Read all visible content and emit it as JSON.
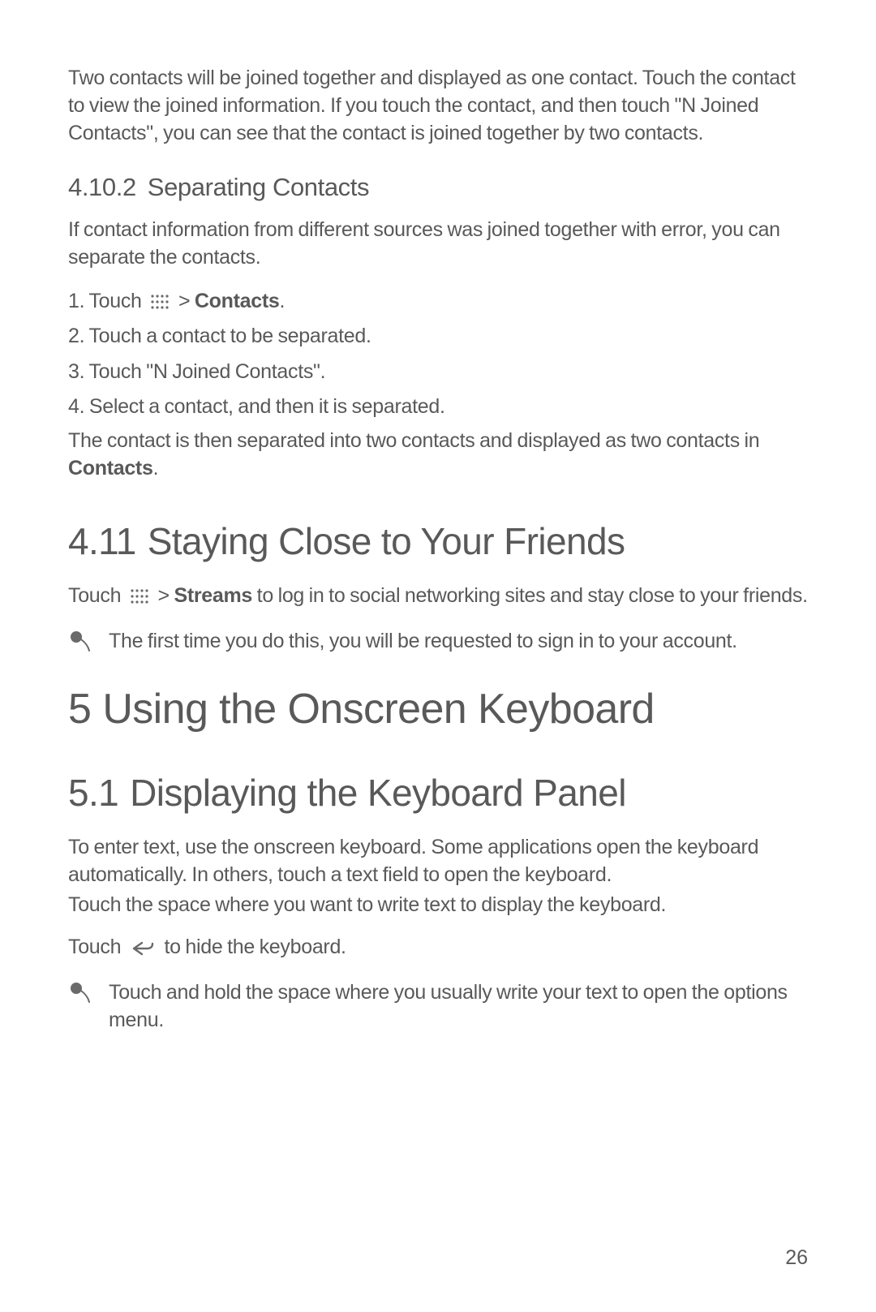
{
  "intro_para": "Two contacts will be joined together and displayed as one contact. Touch the contact to view the joined information. If you touch the contact, and then touch \"N Joined Contacts\", you can see that the contact is joined together by two contacts.",
  "h_4_10_2": {
    "num": "4.10.2",
    "title": "Separating Contacts"
  },
  "sep_para": "If contact information from different sources was joined together with error, you can separate the contacts.",
  "step1_prefix": "1. Touch ",
  "step1_gt": " > ",
  "step1_bold": "Contacts",
  "step1_suffix": ".",
  "step2": "2. Touch a contact to be separated.",
  "step3": "3. Touch \"N Joined Contacts\".",
  "step4": "4. Select a contact, and then it is separated.",
  "sep_result_pre": "The contact is then separated into two contacts and displayed as two contacts in ",
  "sep_result_bold": "Contacts",
  "sep_result_post": ".",
  "h_4_11": {
    "num": "4.11",
    "title": "Staying Close to Your Friends"
  },
  "friends_pre": "Touch ",
  "friends_gt": " > ",
  "friends_bold": "Streams",
  "friends_post": " to log in to social networking sites and stay close to your friends.",
  "note1": "The first time you do this, you will be requested to sign in to your account.",
  "h_5": {
    "num": "5",
    "title": "Using the Onscreen Keyboard"
  },
  "h_5_1": {
    "num": "5.1",
    "title": "Displaying the Keyboard Panel"
  },
  "kbd_para1": "To enter text, use the onscreen keyboard. Some applications open the keyboard automatically. In others, touch a text field to open the keyboard.",
  "kbd_para2": "Touch the space where you want to write text to display the keyboard.",
  "kbd_hide_pre": "Touch ",
  "kbd_hide_post": " to hide the keyboard.",
  "note2": "Touch and hold the space where you usually write your text to open the options menu.",
  "page_number": "26"
}
